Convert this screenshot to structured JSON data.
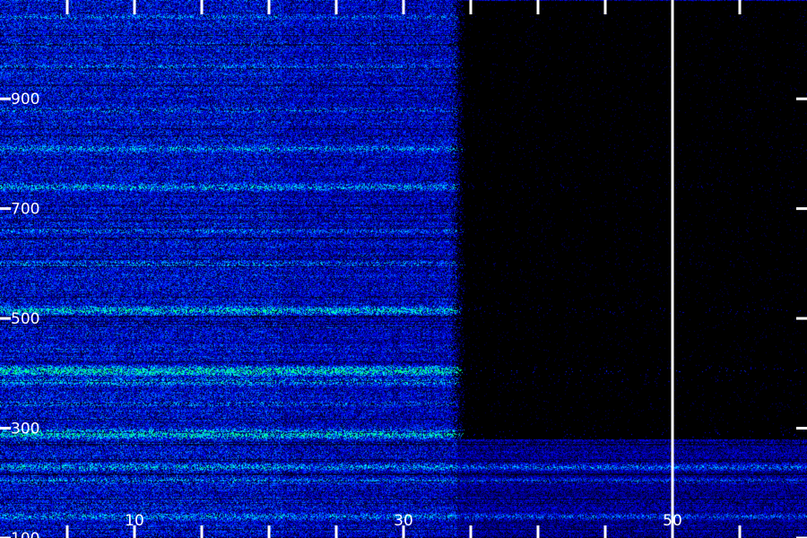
{
  "chart_data": {
    "type": "heatmap",
    "title": "",
    "xlabel": "",
    "ylabel": "",
    "xlim": [
      0,
      60
    ],
    "ylim": [
      100,
      1080
    ],
    "x_ticks": [
      {
        "value": 10,
        "label": "10"
      },
      {
        "value": 30,
        "label": "30"
      },
      {
        "value": 50,
        "label": "50"
      }
    ],
    "y_ticks": [
      {
        "value": 100,
        "label": "100"
      },
      {
        "value": 300,
        "label": "300"
      },
      {
        "value": 500,
        "label": "500"
      },
      {
        "value": 700,
        "label": "700"
      },
      {
        "value": 900,
        "label": "900"
      }
    ],
    "x_minor_tick_step": 5,
    "marker_line": {
      "x": 50,
      "color": "#ffffff"
    },
    "colormap": [
      "#000000",
      "#00007f",
      "#0000ff",
      "#007fff",
      "#00ffff",
      "#00ff7f"
    ],
    "background_color": "#000000",
    "quiet_region": {
      "x_start": 34,
      "y_range": [
        280,
        1080
      ]
    },
    "interference_break": {
      "x": 21
    },
    "strong_bands_y": [
      140,
      205,
      230,
      290,
      345,
      385,
      405,
      515,
      600,
      660,
      740,
      810,
      880,
      960,
      1000,
      1050
    ],
    "strong_bands_level": [
      0.55,
      0.5,
      0.6,
      0.85,
      0.45,
      0.6,
      0.95,
      0.75,
      0.5,
      0.45,
      0.6,
      0.55,
      0.45,
      0.45,
      0.4,
      0.45
    ],
    "bright_band_y": [
      405,
      290,
      515
    ]
  }
}
